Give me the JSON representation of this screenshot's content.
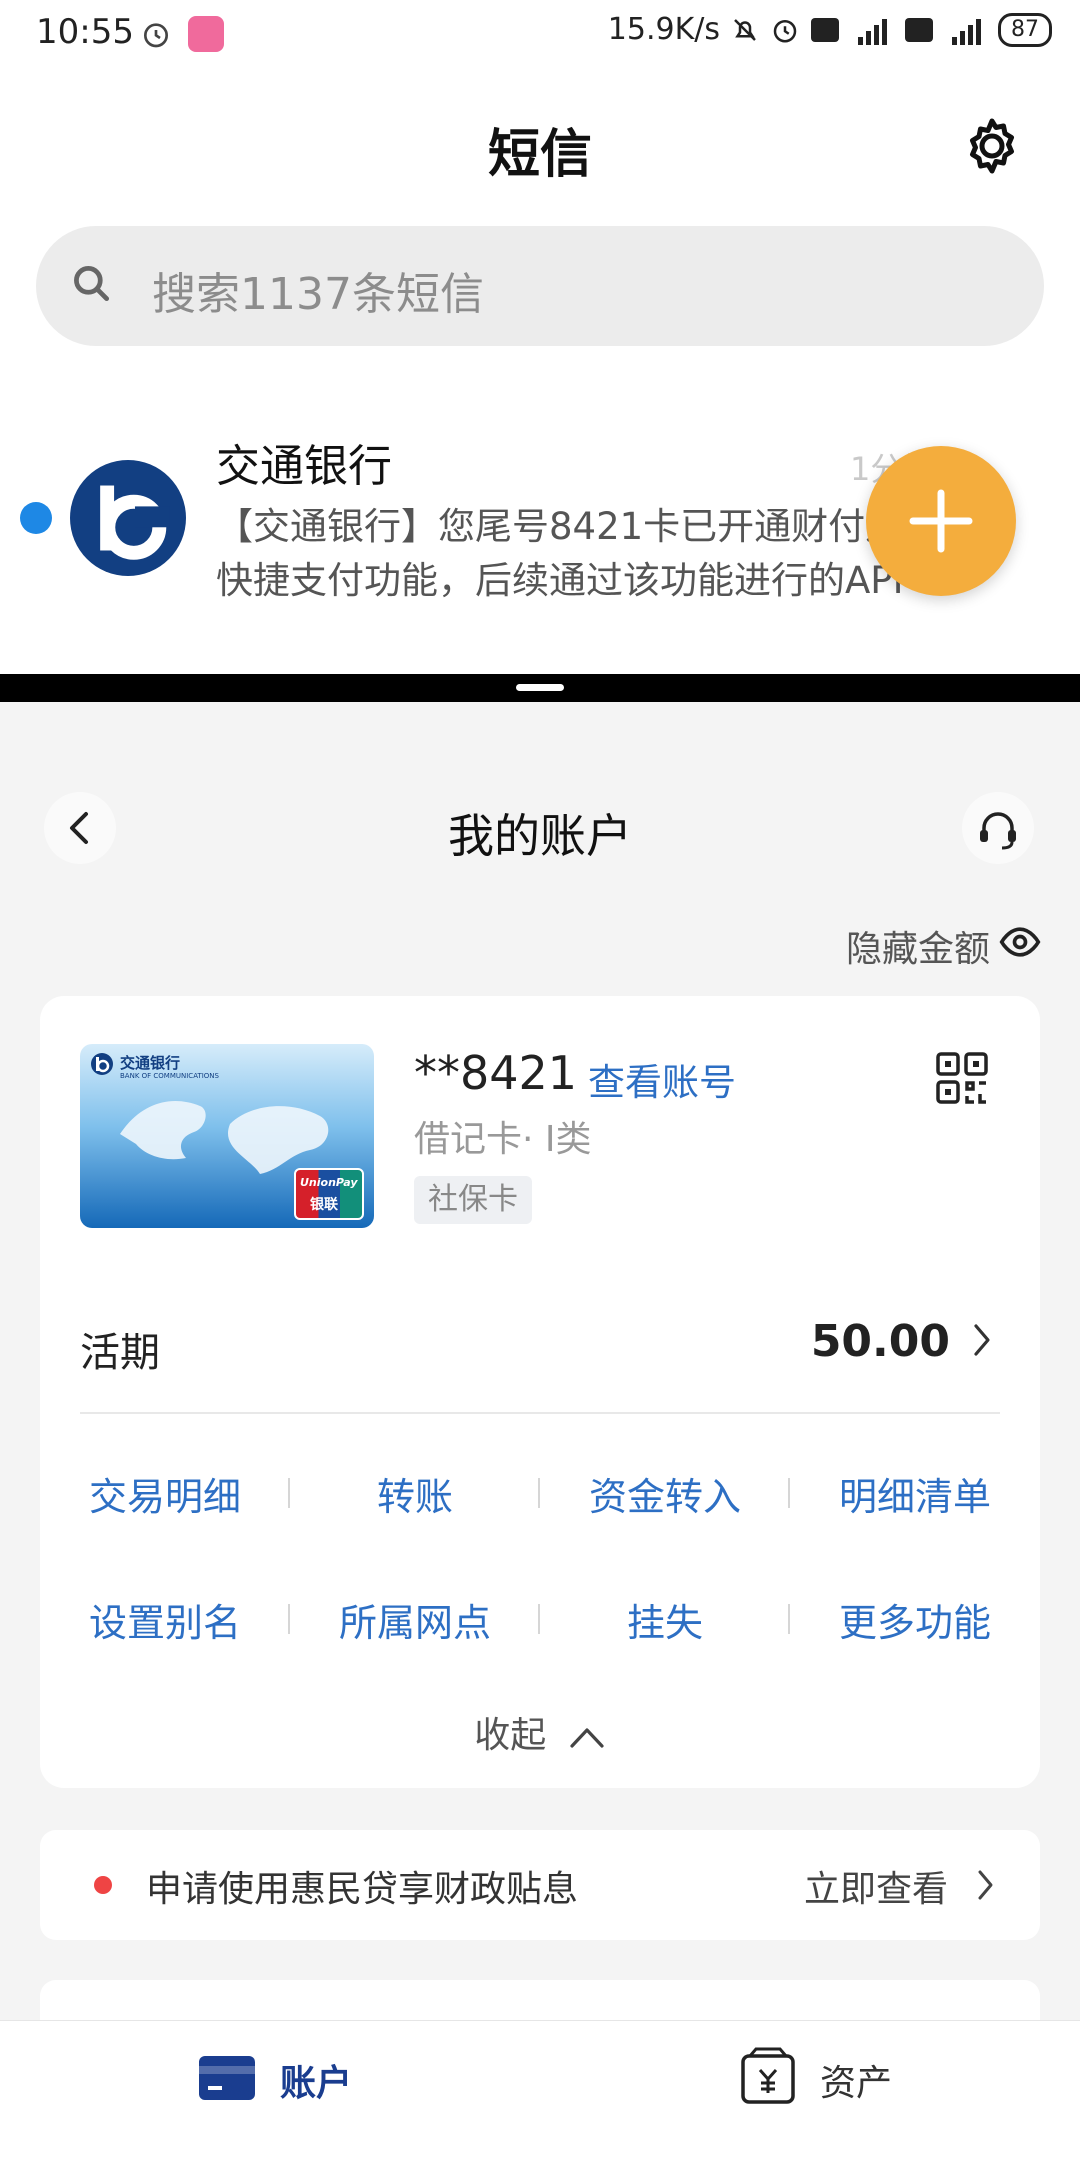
{
  "status_bar": {
    "time": "10:55",
    "speed": "15.9K/s",
    "battery": "87"
  },
  "sms": {
    "title": "短信",
    "search_placeholder": "搜索1137条短信",
    "thread": {
      "sender": "交通银行",
      "preview": "【交通银行】您尾号8421卡已开通财付通快捷支付功能，后续通过该功能进行的API",
      "time": "1分钟"
    }
  },
  "app": {
    "title": "我的账户",
    "hide_amount": "隐藏金额",
    "card": {
      "number": "**8421",
      "view_account": "查看账号",
      "type": "借记卡· I类",
      "tag": "社保卡",
      "bank_name": "交通银行",
      "bank_name_en": "BANK OF COMMUNICATIONS",
      "unionpay": "UnionPay",
      "unionpay_cn": "银联"
    },
    "deposit": {
      "label": "活期",
      "amount": "50.00"
    },
    "actions": [
      [
        "交易明细",
        "转账",
        "资金转入",
        "明细清单"
      ],
      [
        "设置别名",
        "所属网点",
        "挂失",
        "更多功能"
      ]
    ],
    "collapse": "收起",
    "promo": {
      "text": "申请使用惠民贷享财政贴息",
      "link": "立即查看"
    },
    "tabs": [
      {
        "label": "账户",
        "active": true
      },
      {
        "label": "资产",
        "active": false
      }
    ]
  },
  "colors": {
    "fab": "#f4ad3d",
    "link_blue": "#2d6fc4",
    "bank_navy": "#123f82",
    "unread_dot": "#1e88e5",
    "promo_dot": "#ef4444"
  }
}
